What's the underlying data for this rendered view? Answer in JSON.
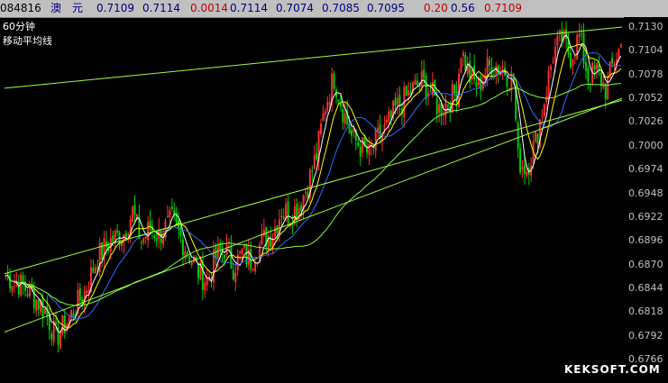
{
  "quote_bar": {
    "code": "084816",
    "name": "澳　元",
    "price": "0.7109",
    "ask": "0.7114",
    "change": "0.0014",
    "open": "0.7114",
    "low": "0.7074",
    "close_prev": "0.7085",
    "value": "0.7095",
    "change_pct": "0.20",
    "amplitude": "0.56",
    "last": "0.7109"
  },
  "chart": {
    "period_label": "60分钟",
    "indicator_label": "移动平均线",
    "watermark": "KEKSOFT.COM"
  },
  "chart_data": {
    "type": "candlestick",
    "y_ticks": [
      "0.7130",
      "0.7104",
      "0.7078",
      "0.7052",
      "0.7026",
      "0.7000",
      "0.6974",
      "0.6948",
      "0.6922",
      "0.6896",
      "0.6870",
      "0.6844",
      "0.6818",
      "0.6792",
      "0.6766"
    ],
    "ylim": [
      0.6766,
      0.713
    ],
    "up_color": "#ff3030",
    "down_color": "#00d000",
    "ma_colors": [
      "#ffffff",
      "#ffff00",
      "#3070ff",
      "#80ff40"
    ],
    "trendline_color": "#a0ff40",
    "anchors": [
      [
        0,
        0.6858
      ],
      [
        6,
        0.685
      ],
      [
        12,
        0.6838
      ],
      [
        18,
        0.682
      ],
      [
        23,
        0.679
      ],
      [
        30,
        0.6815
      ],
      [
        36,
        0.684
      ],
      [
        42,
        0.6878
      ],
      [
        48,
        0.6896
      ],
      [
        54,
        0.6905
      ],
      [
        58,
        0.6928
      ],
      [
        62,
        0.6895
      ],
      [
        66,
        0.691
      ],
      [
        70,
        0.6902
      ],
      [
        76,
        0.6918
      ],
      [
        82,
        0.689
      ],
      [
        88,
        0.6862
      ],
      [
        92,
        0.6852
      ],
      [
        96,
        0.6878
      ],
      [
        100,
        0.6888
      ],
      [
        104,
        0.6868
      ],
      [
        108,
        0.6882
      ],
      [
        112,
        0.6875
      ],
      [
        118,
        0.6898
      ],
      [
        122,
        0.6905
      ],
      [
        126,
        0.693
      ],
      [
        130,
        0.6925
      ],
      [
        134,
        0.6935
      ],
      [
        138,
        0.6958
      ],
      [
        142,
        0.699
      ],
      [
        146,
        0.7045
      ],
      [
        150,
        0.7075
      ],
      [
        154,
        0.704
      ],
      [
        158,
        0.701
      ],
      [
        162,
        0.7
      ],
      [
        166,
        0.699
      ],
      [
        170,
        0.7008
      ],
      [
        174,
        0.702
      ],
      [
        178,
        0.704
      ],
      [
        182,
        0.705
      ],
      [
        186,
        0.7062
      ],
      [
        190,
        0.707
      ],
      [
        194,
        0.706
      ],
      [
        198,
        0.704
      ],
      [
        202,
        0.7048
      ],
      [
        206,
        0.706
      ],
      [
        208,
        0.7105
      ],
      [
        212,
        0.7075
      ],
      [
        216,
        0.7065
      ],
      [
        220,
        0.7085
      ],
      [
        224,
        0.7088
      ],
      [
        228,
        0.7082
      ],
      [
        232,
        0.707
      ],
      [
        234,
        0.6985
      ],
      [
        238,
        0.6975
      ],
      [
        242,
        0.7005
      ],
      [
        246,
        0.705
      ],
      [
        250,
        0.71
      ],
      [
        254,
        0.7118
      ],
      [
        258,
        0.7098
      ],
      [
        262,
        0.712
      ],
      [
        266,
        0.7075
      ],
      [
        270,
        0.7082
      ],
      [
        274,
        0.7062
      ],
      [
        278,
        0.7095
      ],
      [
        281,
        0.7109
      ]
    ],
    "bar_count": 282
  }
}
